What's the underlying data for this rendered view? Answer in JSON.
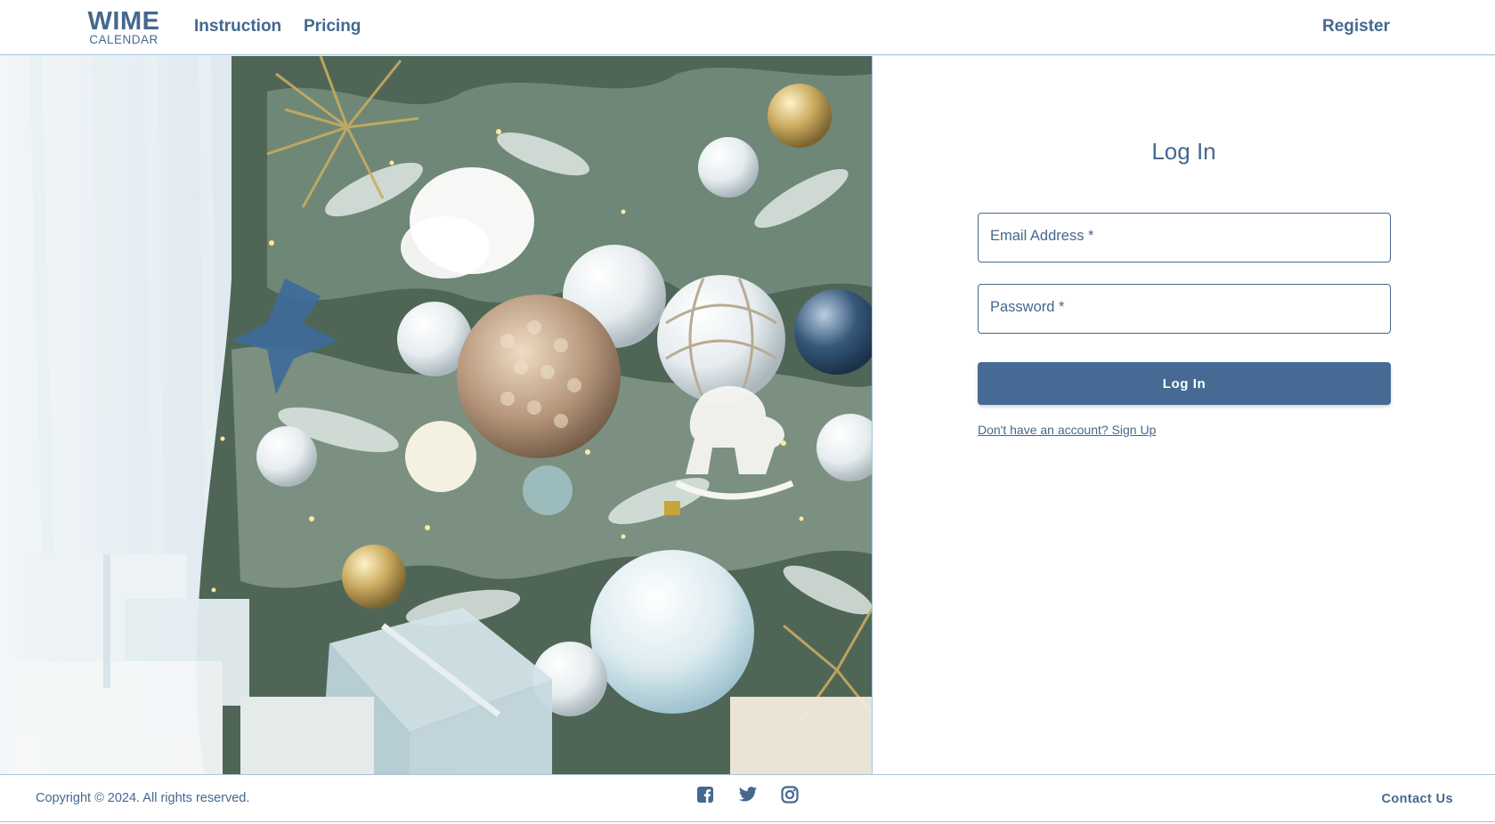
{
  "header": {
    "logo_main": "WIME",
    "logo_sub": "CALENDAR",
    "nav": [
      {
        "label": "Instruction"
      },
      {
        "label": "Pricing"
      }
    ],
    "register_label": "Register"
  },
  "login": {
    "title": "Log In",
    "email_label": "Email Address *",
    "email_value": "",
    "password_label": "Password *",
    "password_value": "",
    "submit_label": "Log In",
    "signup_text": "Don't have an account? Sign Up"
  },
  "footer": {
    "copyright": "Copyright © 2024. All rights reserved.",
    "social_icons": [
      "facebook-icon",
      "twitter-icon",
      "instagram-icon"
    ],
    "contact_label": "Contact Us"
  },
  "colors": {
    "brand": "#45688f",
    "button": "#466a93",
    "divider": "#a9c3da"
  }
}
